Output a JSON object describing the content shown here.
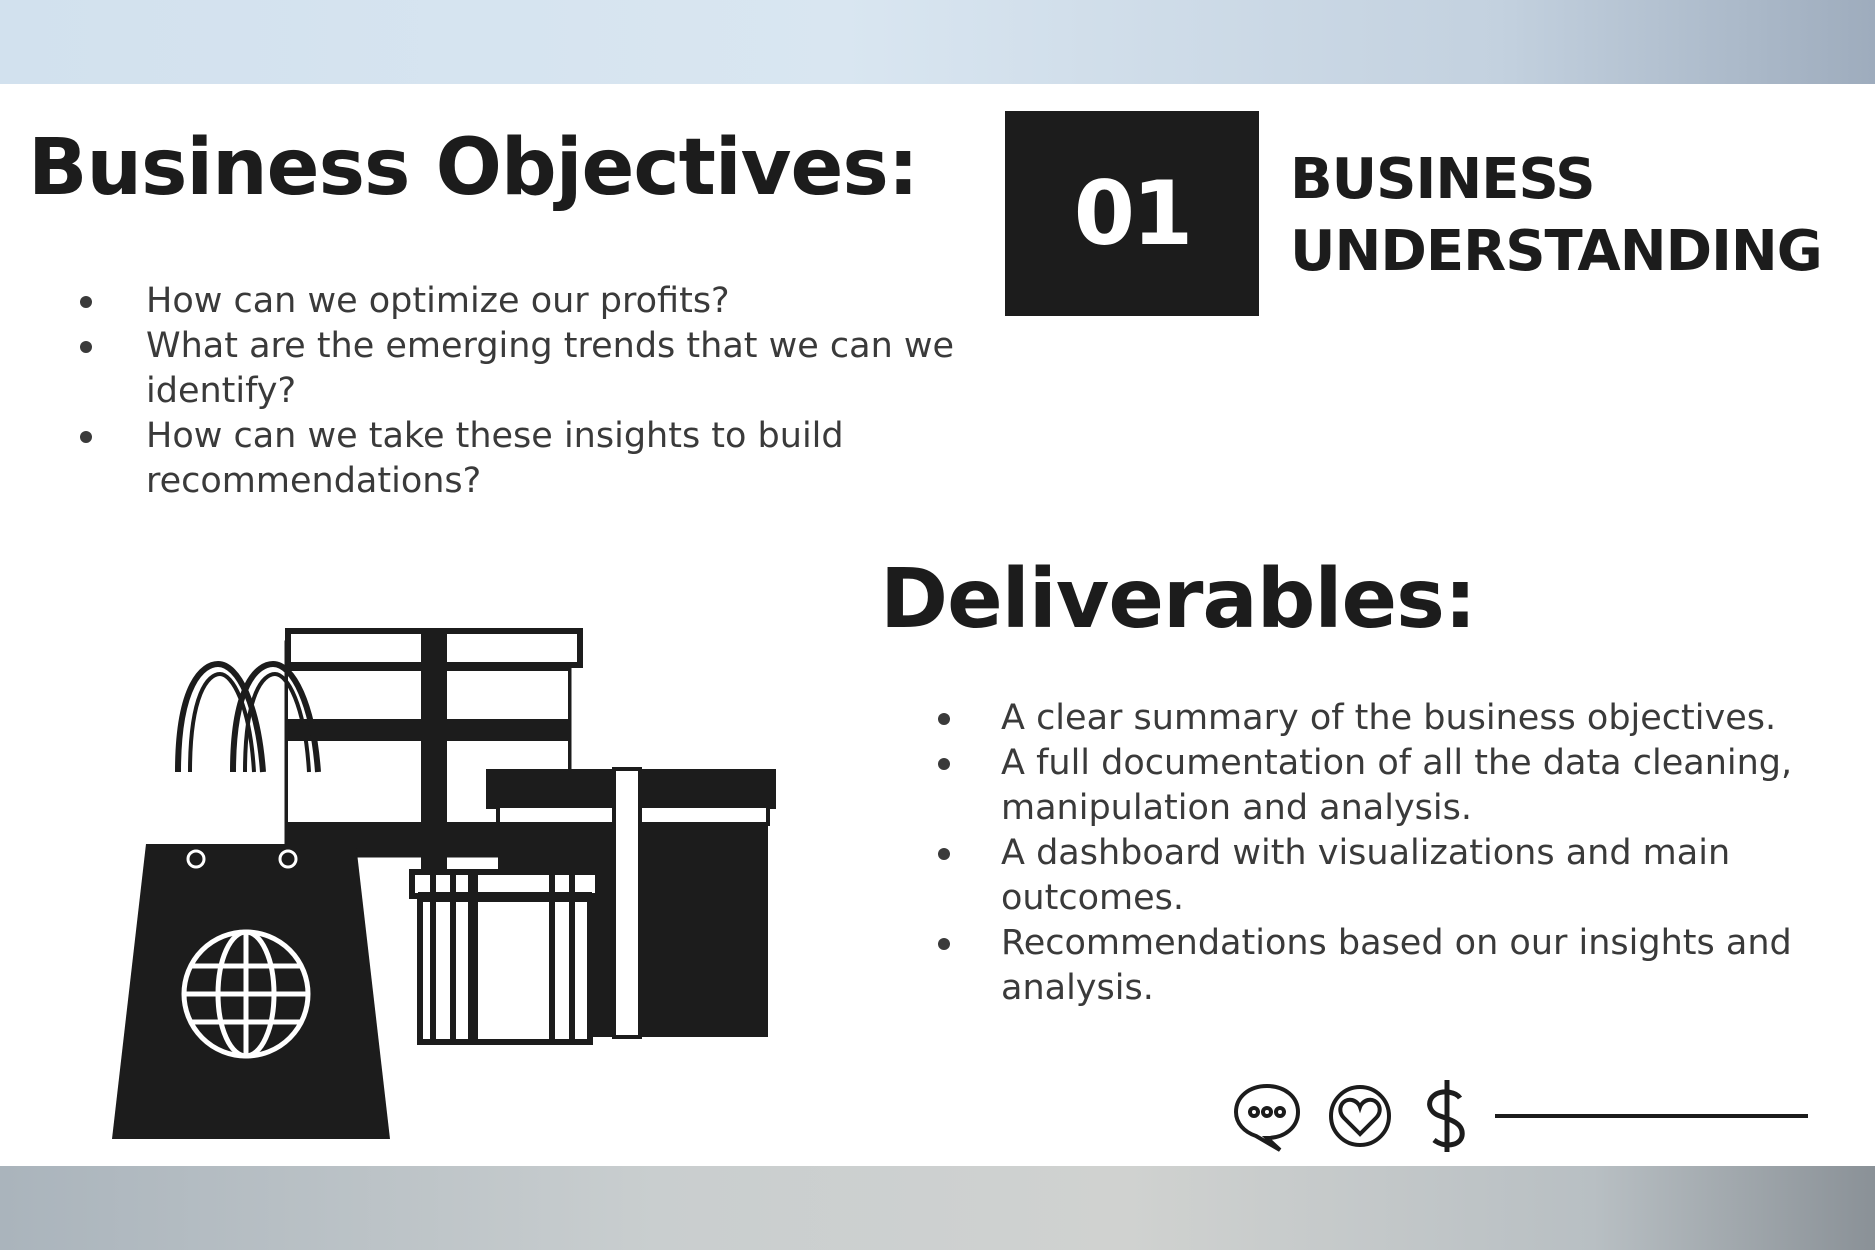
{
  "slide": {
    "objectives_heading": "Business Objectives:",
    "section_number": "01",
    "section_title_line1": "BUSINESS",
    "section_title_line2": "UNDERSTANDING",
    "objectives": [
      "How can we optimize our profits?",
      "What are the emerging trends that we can we identify?",
      "How can we take these insights to build recommendations?"
    ],
    "deliverables_heading": "Deliverables:",
    "deliverables": [
      "A clear summary of the business objectives.",
      "A full documentation of all the data cleaning, manipulation and analysis.",
      "A dashboard with visualizations and main outcomes.",
      "Recommendations based on our insights and analysis."
    ],
    "illustration_icons": [
      "shopping-bag-icon",
      "globe-icon",
      "gift-box-icon"
    ],
    "footer_icons": [
      "speech-bubble-icon",
      "heart-icon",
      "dollar-icon"
    ],
    "colors": {
      "text_dark": "#1c1c1c",
      "body_text": "#3a3a3a",
      "slide_background": "#ffffff"
    }
  }
}
